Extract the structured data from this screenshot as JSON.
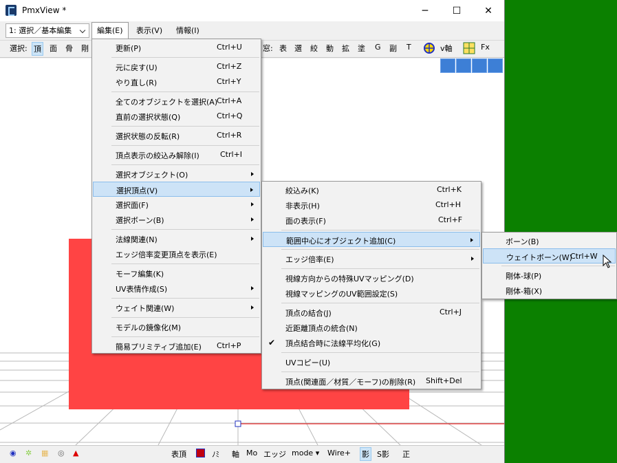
{
  "window": {
    "title": "PmxView *",
    "minimize": "─",
    "maximize": "☐",
    "close": "✕"
  },
  "menubar": {
    "mode": "1: 選択／基本編集",
    "items": [
      "編集(E)",
      "表示(V)",
      "情報(I)"
    ]
  },
  "toolbar": {
    "select_label": "選択:",
    "left": [
      "頂",
      "面",
      "骨",
      "剛"
    ],
    "right": [
      "窓:",
      "表",
      "選",
      "絞",
      "動",
      "拡",
      "塗",
      "G",
      "副",
      "T"
    ],
    "v_axis": "v軸",
    "fx": "Fx"
  },
  "statusbar": {
    "items": [
      "表頂",
      "ﾉﾐ",
      "軸",
      "Mo",
      "エッジ",
      "mode ▾",
      "Wire+",
      "影",
      "S影",
      "正"
    ]
  },
  "edit_menu": {
    "items": [
      {
        "label": "更新(P)",
        "shortcut": "Ctrl+U"
      },
      {
        "label": "元に戻す(U)",
        "shortcut": "Ctrl+Z"
      },
      {
        "label": "やり直し(R)",
        "shortcut": "Ctrl+Y"
      },
      {
        "label": "全てのオブジェクトを選択(A)",
        "shortcut": "Ctrl+A"
      },
      {
        "label": "直前の選択状態(Q)",
        "shortcut": "Ctrl+Q"
      },
      {
        "label": "選択状態の反転(R)",
        "shortcut": "Ctrl+R"
      },
      {
        "label": "頂点表示の絞込み解除(I)",
        "shortcut": "Ctrl+I"
      },
      {
        "label": "選択オブジェクト(O)",
        "shortcut": ""
      },
      {
        "label": "選択頂点(V)",
        "shortcut": ""
      },
      {
        "label": "選択面(F)",
        "shortcut": ""
      },
      {
        "label": "選択ボーン(B)",
        "shortcut": ""
      },
      {
        "label": "法線関連(N)",
        "shortcut": ""
      },
      {
        "label": "エッジ倍率変更頂点を表示(E)",
        "shortcut": ""
      },
      {
        "label": "モーフ編集(K)",
        "shortcut": ""
      },
      {
        "label": "UV表情作成(S)",
        "shortcut": ""
      },
      {
        "label": "ウェイト関連(W)",
        "shortcut": ""
      },
      {
        "label": "モデルの鏡像化(M)",
        "shortcut": ""
      },
      {
        "label": "簡易プリミティブ追加(E)",
        "shortcut": "Ctrl+P"
      }
    ]
  },
  "vertex_menu": {
    "items": [
      {
        "label": "絞込み(K)",
        "shortcut": "Ctrl+K"
      },
      {
        "label": "非表示(H)",
        "shortcut": "Ctrl+H"
      },
      {
        "label": "面の表示(F)",
        "shortcut": "Ctrl+F"
      },
      {
        "label": "範囲中心にオブジェクト追加(C)",
        "shortcut": ""
      },
      {
        "label": "エッジ倍率(E)",
        "shortcut": ""
      },
      {
        "label": "視線方向からの特殊UVマッピング(D)",
        "shortcut": ""
      },
      {
        "label": "視線マッピングのUV範囲設定(S)",
        "shortcut": ""
      },
      {
        "label": "頂点の結合(J)",
        "shortcut": "Ctrl+J"
      },
      {
        "label": "近距離頂点の統合(N)",
        "shortcut": ""
      },
      {
        "label": "頂点結合時に法線平均化(G)",
        "shortcut": ""
      },
      {
        "label": "UVコピー(U)",
        "shortcut": ""
      },
      {
        "label": "頂点(関連面／材質／モーフ)の削除(R)",
        "shortcut": "Shift+Del"
      }
    ]
  },
  "object_menu": {
    "items": [
      {
        "label": "ボーン(B)",
        "shortcut": ""
      },
      {
        "label": "ウェイトボーン(W)",
        "shortcut": "Ctrl+W"
      },
      {
        "label": "剛体-球(P)",
        "shortcut": ""
      },
      {
        "label": "剛体-箱(X)",
        "shortcut": ""
      }
    ]
  },
  "colors": {
    "accent": "#cde3f7",
    "background": "#0b8000",
    "model": "#ff4444"
  }
}
